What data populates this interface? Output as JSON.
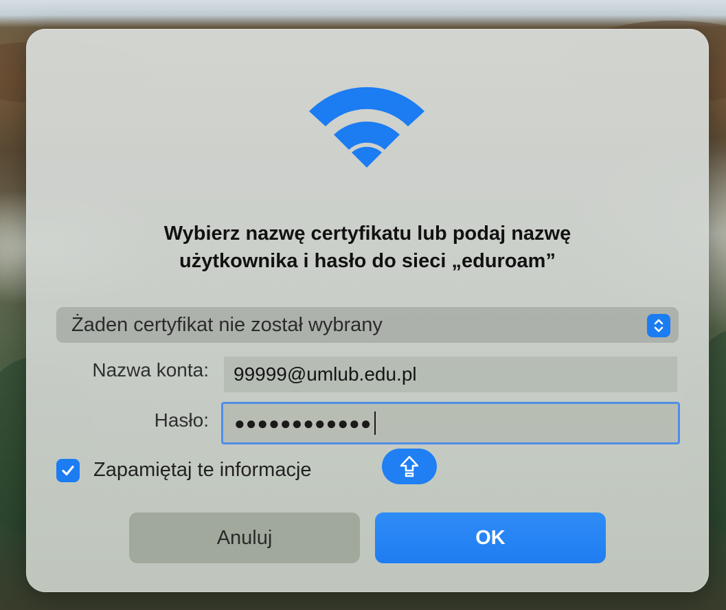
{
  "dialog": {
    "title_line1": "Wybierz nazwę certyfikatu lub podaj nazwę",
    "title_line2": "użytkownika i hasło do sieci „eduroam”",
    "icon": "wifi-icon"
  },
  "certificate": {
    "selected": "Żaden certyfikat nie został wybrany"
  },
  "account": {
    "label": "Nazwa konta:",
    "value": "99999@umlub.edu.pl"
  },
  "password": {
    "label": "Hasło:",
    "masked_value": "●●●●●●●●●●●●"
  },
  "remember": {
    "label": "Zapamiętaj te informacje",
    "checked": true
  },
  "buttons": {
    "cancel": "Anuluj",
    "ok": "OK"
  },
  "colors": {
    "accent": "#1c7cf2"
  }
}
